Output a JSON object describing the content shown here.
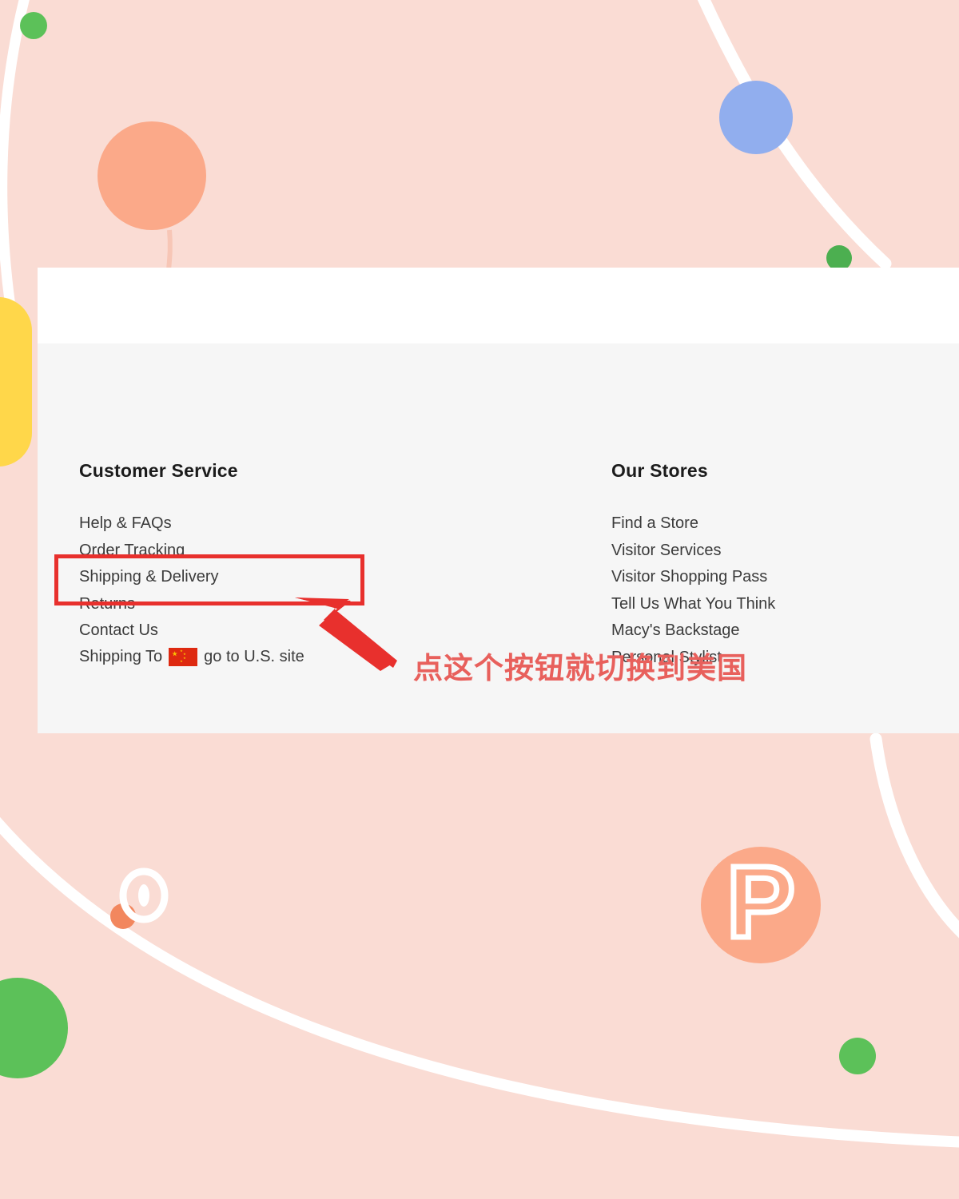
{
  "page": {
    "background_color": "#fadcd4",
    "card_background": "#ffffff",
    "footer_background": "#f6f6f6"
  },
  "footer": {
    "columns": [
      {
        "id": "customer-service",
        "heading": "Customer Service",
        "links": [
          "Help & FAQs",
          "Order Tracking",
          "Shipping & Delivery",
          "Returns",
          "Contact Us"
        ]
      },
      {
        "id": "our-stores",
        "heading": "Our Stores",
        "links": [
          "Find a Store",
          "Visitor Services",
          "Visitor Shopping Pass",
          "Tell Us What You Think",
          "Macy's Backstage",
          "Personal Stylist"
        ]
      }
    ],
    "shipping_to": {
      "label": "Shipping To",
      "flag": "flag-china-icon",
      "action_label": "go to U.S. site"
    }
  },
  "annotation": {
    "highlight_color": "#e8302d",
    "arrow_color": "#e8302d",
    "text": "点这个按钮就切换到美国",
    "text_color": "#e8605c"
  },
  "decorations": {
    "pink_background": "#fadcd4",
    "peach_circle": "#fba989",
    "blue_circle": "#91aeee",
    "green_circle": "#5cc159",
    "yellow_shape": "#ffd74a",
    "white_curve": "#ffffff",
    "logo_letter": "P"
  }
}
